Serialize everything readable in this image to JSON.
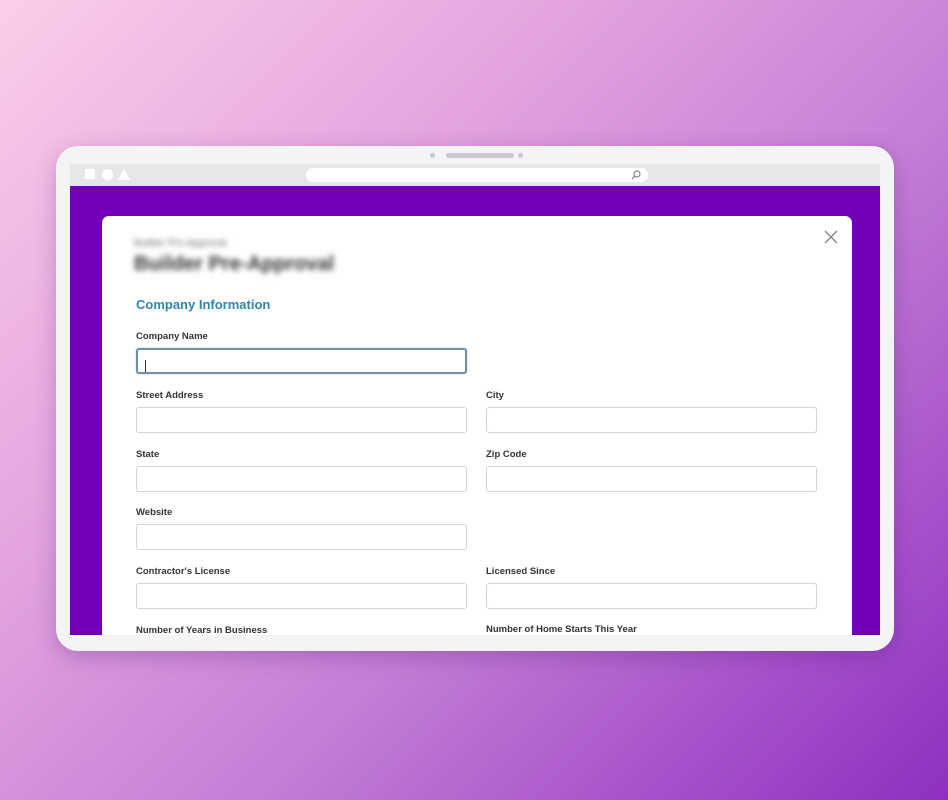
{
  "device": {
    "accent": "#7200b6"
  },
  "browser": {
    "window_controls": [
      "square-icon",
      "circle-icon",
      "triangle-icon"
    ],
    "address_bar": {
      "value": "",
      "icon": "search-icon"
    }
  },
  "modal": {
    "eyebrow": "Builder Pre-Approval",
    "title": "Builder Pre-Approval",
    "close_icon": "close-icon",
    "section_title": "Company Information",
    "section_color": "#2e86ab",
    "fields": {
      "company_name": {
        "label": "Company Name",
        "value": ""
      },
      "street_address": {
        "label": "Street Address",
        "value": ""
      },
      "city": {
        "label": "City",
        "value": ""
      },
      "state": {
        "label": "State",
        "value": ""
      },
      "zip_code": {
        "label": "Zip Code",
        "value": ""
      },
      "website": {
        "label": "Website",
        "value": ""
      },
      "contractors_license": {
        "label": "Contractor's License",
        "value": ""
      },
      "licensed_since": {
        "label": "Licensed Since",
        "value": ""
      },
      "years_in_business": {
        "label": "Number of Years in Business",
        "value": ""
      },
      "home_starts": {
        "label": "Number of Home Starts This Year",
        "value": ""
      }
    }
  }
}
